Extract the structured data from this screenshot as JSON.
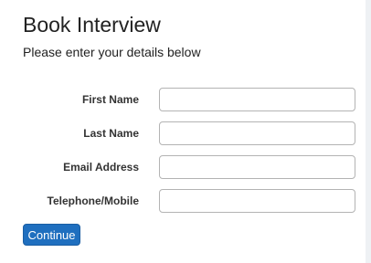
{
  "page": {
    "title": "Book Interview",
    "subtitle": "Please enter your details below"
  },
  "form": {
    "fields": [
      {
        "label": "First Name",
        "value": "",
        "placeholder": ""
      },
      {
        "label": "Last Name",
        "value": "",
        "placeholder": ""
      },
      {
        "label": "Email Address",
        "value": "",
        "placeholder": ""
      },
      {
        "label": "Telephone/Mobile",
        "value": "",
        "placeholder": ""
      }
    ],
    "submit_label": "Continue"
  },
  "colors": {
    "button_bg": "#1f6fbf",
    "background": "#eef1f4"
  }
}
